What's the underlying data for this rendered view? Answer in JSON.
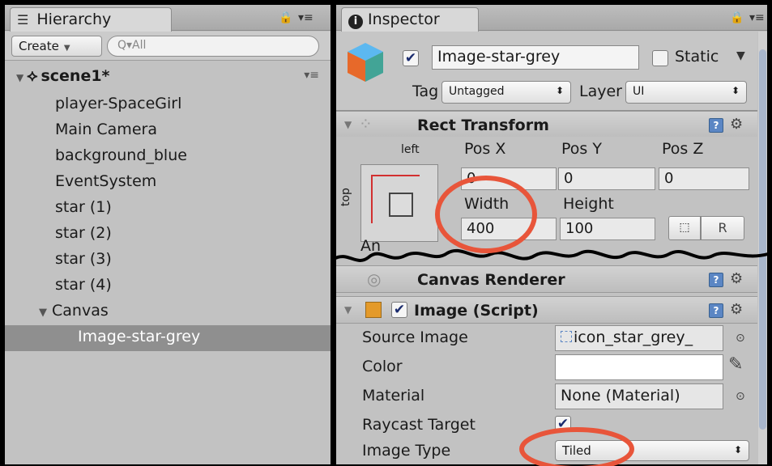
{
  "hierarchy": {
    "tab_title": "Hierarchy",
    "create_label": "Create",
    "search_placeholder": "Q▾All",
    "scene_name": "scene1*",
    "items": [
      {
        "label": "player-SpaceGirl"
      },
      {
        "label": "Main Camera"
      },
      {
        "label": "background_blue"
      },
      {
        "label": "EventSystem"
      },
      {
        "label": "star (1)"
      },
      {
        "label": "star (2)"
      },
      {
        "label": "star (3)"
      },
      {
        "label": "star (4)"
      },
      {
        "label": "Canvas"
      },
      {
        "label": "Image-star-grey"
      }
    ],
    "selected_item": "Image-star-grey"
  },
  "inspector": {
    "tab_title": "Inspector",
    "object_name": "Image-star-grey",
    "active": true,
    "static_label": "Static",
    "static_checked": false,
    "tag_label": "Tag",
    "tag_value": "Untagged",
    "layer_label": "Layer",
    "layer_value": "UI",
    "rect_transform": {
      "title": "Rect Transform",
      "anchor_h_label": "left",
      "anchor_v_label": "top",
      "pos_x_label": "Pos X",
      "pos_y_label": "Pos Y",
      "pos_z_label": "Pos Z",
      "pos_x": "0",
      "pos_y": "0",
      "pos_z": "0",
      "width_label": "Width",
      "height_label": "Height",
      "width": "400",
      "height": "100",
      "raw_button": "R"
    },
    "anchor_partial": "An",
    "canvas_renderer_title": "Canvas Renderer",
    "image_script": {
      "title": "Image (Script)",
      "enabled": true,
      "source_image_label": "Source Image",
      "source_image_value": "icon_star_grey_",
      "color_label": "Color",
      "color_value": "#ffffff",
      "material_label": "Material",
      "material_value": "None (Material)",
      "raycast_label": "Raycast Target",
      "raycast_checked": true,
      "image_type_label": "Image Type",
      "image_type_value": "Tiled"
    }
  },
  "highlight_color": "#e8553a"
}
